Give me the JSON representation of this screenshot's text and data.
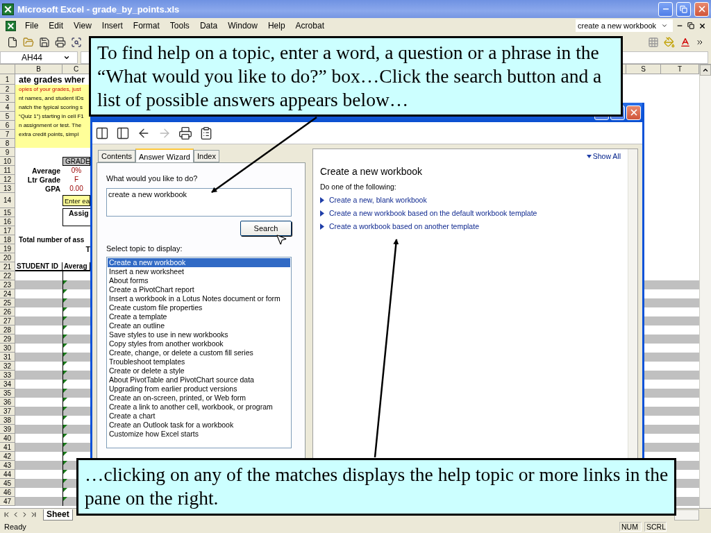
{
  "window": {
    "title": "Microsoft Excel - grade_by_points.xls"
  },
  "menu": [
    "File",
    "Edit",
    "View",
    "Insert",
    "Format",
    "Tools",
    "Data",
    "Window",
    "Help",
    "Acrobat"
  ],
  "ask_box": {
    "value": "create a new workbook"
  },
  "name_box": "AH44",
  "sheet": {
    "columns": [
      "B",
      "C",
      "S",
      "T"
    ],
    "rows": [
      {
        "n": "1",
        "kind": "title",
        "text": "ate grades wher"
      },
      {
        "n": "2",
        "kind": "note",
        "text": "opies of your grades, just",
        "highlight": true
      },
      {
        "n": "3",
        "kind": "note",
        "text": "nt names, and student IDs",
        "highlight": false
      },
      {
        "n": "4",
        "kind": "note",
        "text": "natch the typical scoring s",
        "highlight": false
      },
      {
        "n": "5",
        "kind": "note",
        "text": "“Quiz 1”) starting in cell F1",
        "highlight": false
      },
      {
        "n": "6",
        "kind": "note",
        "text": "n assignment or test. The",
        "highlight": false
      },
      {
        "n": "7",
        "kind": "note",
        "text": "extra credit points, simpl",
        "highlight": false
      },
      {
        "n": "8",
        "kind": "note"
      },
      {
        "n": "9",
        "kind": "blank"
      },
      {
        "n": "10",
        "kind": "grade-header",
        "c": "GRADE"
      },
      {
        "n": "11",
        "kind": "stat",
        "b": "Average",
        "c": "0%"
      },
      {
        "n": "12",
        "kind": "stat",
        "b": "Ltr Grade",
        "c": "F"
      },
      {
        "n": "13",
        "kind": "stat",
        "b": "GPA",
        "c": "0.00"
      },
      {
        "n": "14",
        "kind": "prompt",
        "c": "Enter ea"
      },
      {
        "n": "15",
        "kind": "box",
        "c": "Assig"
      },
      {
        "n": "16",
        "kind": "box"
      },
      {
        "n": "17",
        "kind": "blank"
      },
      {
        "n": "18",
        "kind": "total",
        "text": "Total number of ass"
      },
      {
        "n": "19",
        "kind": "partial",
        "c": "T"
      },
      {
        "n": "20",
        "kind": "blank"
      },
      {
        "n": "21",
        "kind": "head",
        "b": "STUDENT ID",
        "c": "Averag"
      },
      {
        "n": "22",
        "kind": "entry",
        "shaded": false,
        "flagged": false
      },
      {
        "n": "23",
        "kind": "entry",
        "shaded": true,
        "flagged": true
      },
      {
        "n": "24",
        "kind": "entry",
        "shaded": false,
        "flagged": true
      },
      {
        "n": "25",
        "kind": "entry",
        "shaded": true,
        "flagged": true
      },
      {
        "n": "26",
        "kind": "entry",
        "shaded": false,
        "flagged": true
      },
      {
        "n": "27",
        "kind": "entry",
        "shaded": true,
        "flagged": true
      },
      {
        "n": "28",
        "kind": "entry",
        "shaded": false,
        "flagged": true
      },
      {
        "n": "29",
        "kind": "entry",
        "shaded": true,
        "flagged": true
      },
      {
        "n": "30",
        "kind": "entry",
        "shaded": false,
        "flagged": true
      },
      {
        "n": "31",
        "kind": "entry",
        "shaded": true,
        "flagged": true
      },
      {
        "n": "32",
        "kind": "entry",
        "shaded": false,
        "flagged": true
      },
      {
        "n": "33",
        "kind": "entry",
        "shaded": true,
        "flagged": true
      },
      {
        "n": "34",
        "kind": "entry",
        "shaded": false,
        "flagged": true
      },
      {
        "n": "35",
        "kind": "entry",
        "shaded": true,
        "flagged": true
      },
      {
        "n": "36",
        "kind": "entry",
        "shaded": false,
        "flagged": true
      },
      {
        "n": "37",
        "kind": "entry",
        "shaded": true,
        "flagged": true
      },
      {
        "n": "38",
        "kind": "entry",
        "shaded": false,
        "flagged": true
      },
      {
        "n": "39",
        "kind": "entry",
        "shaded": true,
        "flagged": true
      },
      {
        "n": "40",
        "kind": "entry",
        "shaded": false,
        "flagged": true
      },
      {
        "n": "41",
        "kind": "entry",
        "shaded": true,
        "flagged": true
      },
      {
        "n": "42",
        "kind": "entry",
        "shaded": false,
        "flagged": true
      },
      {
        "n": "43",
        "kind": "entry",
        "shaded": true,
        "flagged": true
      },
      {
        "n": "44",
        "kind": "entry",
        "shaded": false,
        "flagged": true
      },
      {
        "n": "45",
        "kind": "entry",
        "shaded": true,
        "flagged": true
      },
      {
        "n": "46",
        "kind": "entry",
        "shaded": false,
        "flagged": true
      },
      {
        "n": "47",
        "kind": "entry",
        "shaded": true,
        "flagged": true
      }
    ]
  },
  "sheet_tabs": [
    {
      "label": "Sheet",
      "selected": true
    }
  ],
  "status_bar": {
    "text": "Ready",
    "indicators": [
      "NUM",
      "SCRL"
    ]
  },
  "help_window": {
    "toolbar": [
      {
        "kind": "tile",
        "disabled": false
      },
      {
        "kind": "pane",
        "disabled": false
      },
      {
        "kind": "back",
        "disabled": false
      },
      {
        "kind": "forward",
        "disabled": true
      },
      {
        "kind": "print",
        "disabled": false
      },
      {
        "kind": "options",
        "disabled": false
      }
    ],
    "tabs": [
      {
        "label": "Contents",
        "selected": false
      },
      {
        "label": "Answer Wizard",
        "selected": true
      },
      {
        "label": "Index",
        "selected": false
      }
    ],
    "question_label": "What would you like to do?",
    "question": "create a new workbook",
    "search_button": "Search",
    "topics_label": "Select topic to display:",
    "topics": [
      {
        "label": "Create a new workbook",
        "selected": true
      },
      {
        "label": "Insert a new worksheet",
        "selected": false
      },
      {
        "label": "About forms",
        "selected": false
      },
      {
        "label": "Create a PivotChart report",
        "selected": false
      },
      {
        "label": "Insert a workbook in a Lotus Notes document or form",
        "selected": false
      },
      {
        "label": "Create custom file properties",
        "selected": false
      },
      {
        "label": "Create a template",
        "selected": false
      },
      {
        "label": "Create an outline",
        "selected": false
      },
      {
        "label": "Save styles to use in new workbooks",
        "selected": false
      },
      {
        "label": "Copy styles from another workbook",
        "selected": false
      },
      {
        "label": "Create, change, or delete a custom fill series",
        "selected": false
      },
      {
        "label": "Troubleshoot templates",
        "selected": false
      },
      {
        "label": "Create or delete a style",
        "selected": false
      },
      {
        "label": "About PivotTable and PivotChart source data",
        "selected": false
      },
      {
        "label": "Upgrading from earlier product versions",
        "selected": false
      },
      {
        "label": "Create an on-screen, printed, or Web form",
        "selected": false
      },
      {
        "label": "Create a link to another cell, workbook, or program",
        "selected": false
      },
      {
        "label": "Create a chart",
        "selected": false
      },
      {
        "label": "Create an Outlook task for a workbook",
        "selected": false
      },
      {
        "label": "Customize how Excel starts",
        "selected": false
      }
    ],
    "show_all": "Show All",
    "heading": "Create a new workbook",
    "intro": "Do one of the following:",
    "links": [
      "Create a new, blank workbook",
      "Create a new workbook based on the default workbook template",
      "Create a workbook based on another template"
    ]
  },
  "callouts": [
    {
      "text": "To find help on a topic, enter a word, a question or a phrase in the “What would you like to do?” box…Click the search button and a list of possible answers appears below…"
    },
    {
      "text": "…clicking on any of the matches displays the help topic or more links in the pane on the right."
    }
  ]
}
